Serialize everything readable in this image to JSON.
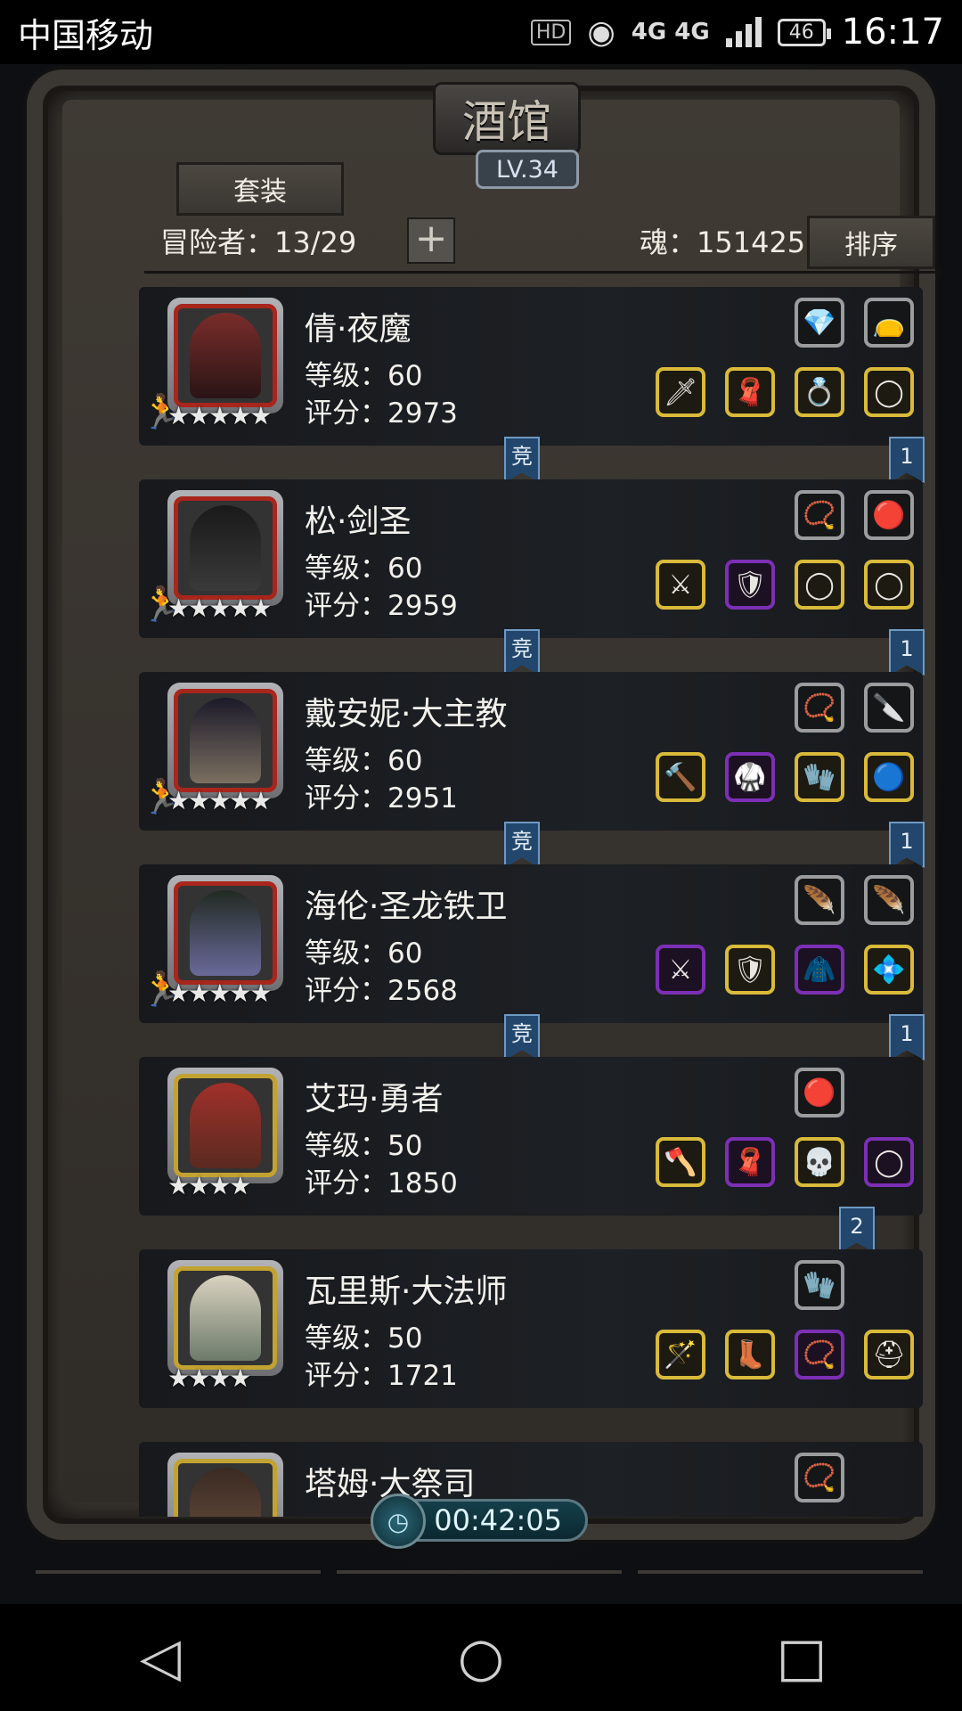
{
  "status_bar": {
    "carrier": "中国移动",
    "hd": "HD",
    "network": "4G 4G",
    "battery": "46",
    "time": "16:17"
  },
  "header": {
    "title": "酒馆",
    "level": "LV.34",
    "set_button": "套装",
    "adventurers": "冒险者：13/29",
    "add_icon": "+",
    "souls": "魂：151425",
    "sort_button": "排序"
  },
  "heroes": [
    {
      "name": "倩·夜魔",
      "level": "等级：60",
      "score": "评分：2973",
      "stars": "★★★★★",
      "ribbon_left": "竞",
      "ribbon_right": "1"
    },
    {
      "name": "松·剑圣",
      "level": "等级：60",
      "score": "评分：2959",
      "stars": "★★★★★",
      "ribbon_left": "竞",
      "ribbon_right": "1"
    },
    {
      "name": "戴安妮·大主教",
      "level": "等级：60",
      "score": "评分：2951",
      "stars": "★★★★★",
      "ribbon_left": "竞",
      "ribbon_right": "1"
    },
    {
      "name": "海伦·圣龙铁卫",
      "level": "等级：60",
      "score": "评分：2568",
      "stars": "★★★★★",
      "ribbon_left": "竞",
      "ribbon_right": "1"
    },
    {
      "name": "艾玛·勇者",
      "level": "等级：50",
      "score": "评分：1850",
      "stars": "★★★★",
      "ribbon_right": "2"
    },
    {
      "name": "瓦里斯·大法师",
      "level": "等级：50",
      "score": "评分：1721",
      "stars": "★★★★"
    },
    {
      "name": "塔姆·大祭司"
    }
  ],
  "timer": "00:42:05",
  "nav": {
    "back": "◁",
    "home": "○",
    "recent": "□"
  },
  "colors": {
    "gold_slot": "#d9ba3a",
    "purple_slot": "#7c2fb5",
    "red_frame": "#a8261c",
    "gold_frame": "#c2a231",
    "ribbon": "#23476c"
  }
}
